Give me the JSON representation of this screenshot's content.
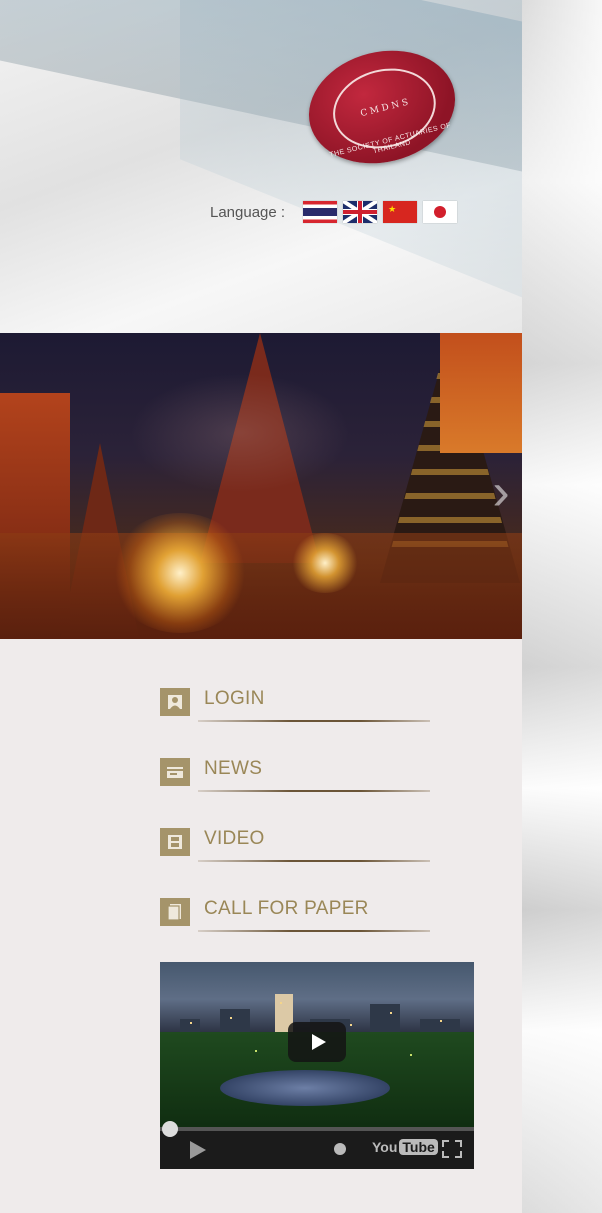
{
  "header": {
    "logo_text": "THE SOCIETY OF ACTUARIES OF THAILAND",
    "language_label": "Language :",
    "languages": [
      {
        "code": "th",
        "icon": "thai-flag-icon"
      },
      {
        "code": "en",
        "icon": "uk-flag-icon"
      },
      {
        "code": "cn",
        "icon": "china-flag-icon"
      },
      {
        "code": "jp",
        "icon": "japan-flag-icon"
      }
    ]
  },
  "banner": {
    "next_icon": "chevron-right-icon"
  },
  "menu": {
    "items": [
      {
        "label": "LOGIN",
        "icon": "user-icon"
      },
      {
        "label": "NEWS",
        "icon": "card-icon"
      },
      {
        "label": "VIDEO",
        "icon": "film-icon"
      },
      {
        "label": "CALL FOR PAPER",
        "icon": "document-icon"
      }
    ]
  },
  "video": {
    "brand_you": "You",
    "brand_tube": "Tube"
  },
  "colors": {
    "menu_accent": "#9a8757",
    "icon_bg": "#a5946a"
  }
}
